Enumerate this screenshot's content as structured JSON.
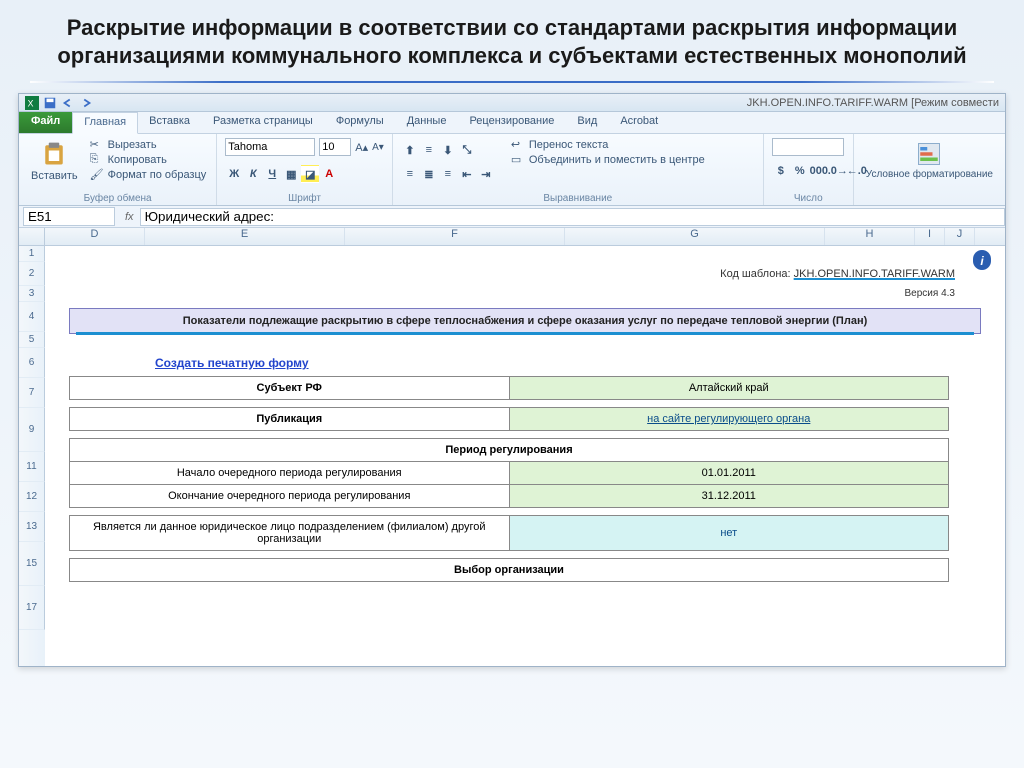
{
  "slide": {
    "title": "Раскрытие информации в соответствии со стандартами раскрытия информации организациями коммунального комплекса и субъектами естественных монополий"
  },
  "window": {
    "doc_title": "JKH.OPEN.INFO.TARIFF.WARM [Режим совмести"
  },
  "ribbon": {
    "file": "Файл",
    "tabs": [
      "Главная",
      "Вставка",
      "Разметка страницы",
      "Формулы",
      "Данные",
      "Рецензирование",
      "Вид",
      "Acrobat"
    ],
    "clipboard": {
      "paste": "Вставить",
      "cut": "Вырезать",
      "copy": "Копировать",
      "format_painter": "Формат по образцу",
      "label": "Буфер обмена"
    },
    "font": {
      "name": "Tahoma",
      "size": "10",
      "bold": "Ж",
      "italic": "К",
      "underline": "Ч",
      "label": "Шрифт"
    },
    "alignment": {
      "wrap": "Перенос текста",
      "merge": "Объединить и поместить в центре",
      "label": "Выравнивание"
    },
    "number": {
      "label": "Число"
    },
    "styles": {
      "cond_fmt": "Условное форматирование"
    }
  },
  "formula_bar": {
    "namebox": "E51",
    "fx": "fx",
    "formula": "Юридический адрес:"
  },
  "columns": [
    "D",
    "E",
    "F",
    "G",
    "H",
    "I",
    "J"
  ],
  "rows": [
    "1",
    "2",
    "3",
    "4",
    "5",
    "6",
    "7",
    "9",
    "11",
    "12",
    "13",
    "15",
    "17"
  ],
  "template": {
    "code_prefix": "Код шаблона: ",
    "code": "JKH.OPEN.INFO.TARIFF.WARM",
    "version": "Версия 4.3",
    "banner": "Показатели подлежащие раскрытию в сфере теплоснабжения и сфере оказания услуг по передаче тепловой энергии (План)",
    "print_link": "Создать печатную форму",
    "fields": {
      "subject_label": "Субъект РФ",
      "subject_value": "Алтайский край",
      "publication_label": "Публикация",
      "publication_value": "на сайте регулирующего органа",
      "period_section": "Период регулирования",
      "period_start_label": "Начало очередного периода регулирования",
      "period_start_value": "01.01.2011",
      "period_end_label": "Окончание очередного периода регулирования",
      "period_end_value": "31.12.2011",
      "branch_label": "Является ли данное юридическое лицо подразделением (филиалом) другой организации",
      "branch_value": "нет",
      "org_section": "Выбор организации"
    },
    "info_glyph": "i"
  }
}
